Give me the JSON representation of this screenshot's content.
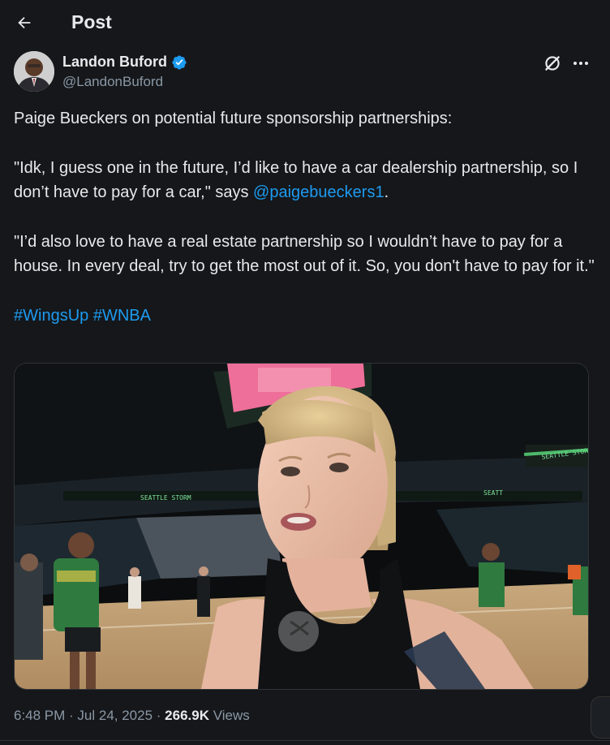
{
  "header": {
    "title": "Post",
    "back_icon": "arrow-left-icon"
  },
  "author": {
    "name": "Landon Buford",
    "handle": "@LandonBuford",
    "verified_color": "#1d9bf0",
    "avatar_icon": "avatar-photo"
  },
  "actions": {
    "grok_icon": "grok-icon",
    "more_icon": "more-horizontal-icon"
  },
  "tweet": {
    "line1": "Paige Bueckers on potential future sponsorship partnerships:",
    "quote1_pre": "\"Idk, I guess one in the future, I’d like to have a car dealership partnership, so I don’t have to pay for a car,\" says ",
    "mention": "@paigebueckers1",
    "quote1_post": ".",
    "quote2": "\"I’d also love to have a real estate partnership so I wouldn’t have to pay for a house. In every deal, try to get the most out of it. So, you don't have to pay for it.\"",
    "hashtag1": "#WingsUp",
    "hashtag2": "#WNBA"
  },
  "media": {
    "arena_sign1": "SEATTLE STORM",
    "arena_sign2": "SEATTLE STORM",
    "arena_sign3": "SEATT"
  },
  "meta": {
    "time": "6:48 PM",
    "sep1": " · ",
    "date": "Jul 24, 2025",
    "sep2": " · ",
    "views_count": "266.9K",
    "views_label": " Views"
  },
  "colors": {
    "background": "#15171a",
    "text": "#e7e9ea",
    "muted": "#8b98a5",
    "link": "#1d9bf0"
  }
}
